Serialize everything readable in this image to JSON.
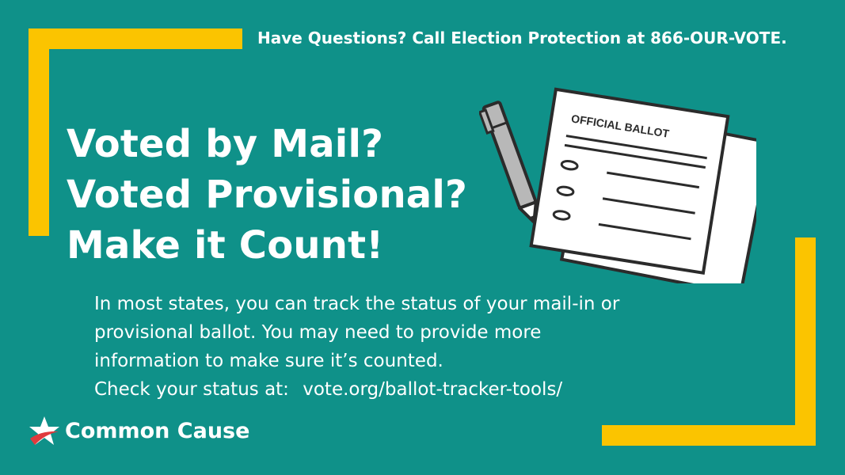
{
  "top_notice": "Have Questions? Call Election Protection at 866-OUR-VOTE.",
  "headline": {
    "line1": "Voted by Mail?",
    "line2": "Voted Provisional?",
    "line3": "Make it Count!"
  },
  "body": {
    "line1": "In most states, you can track the status of your mail-in or",
    "line2": "provisional ballot. You may need to provide more",
    "line3": "information to make sure it’s counted.",
    "status_label": "Check your status at:",
    "status_url": "vote.org/ballot-tracker-tools/"
  },
  "ballot": {
    "title": "OFFICIAL BALLOT"
  },
  "logo": {
    "name": "Common Cause"
  },
  "colors": {
    "background": "#0f9189",
    "frame": "#fbc400",
    "text": "#ffffff",
    "logo_star_red": "#e03a3e"
  }
}
